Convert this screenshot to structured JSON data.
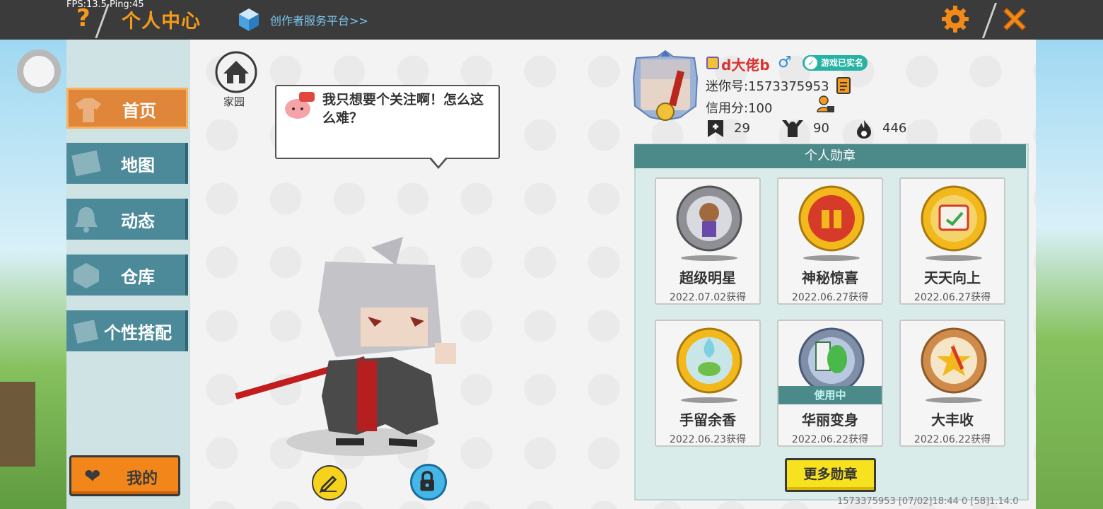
{
  "debug": {
    "fps_ping": "FPS:13.5  Ping:45"
  },
  "header": {
    "title": "个人中心",
    "creator_link": "创作者服务平台>>"
  },
  "sidebar": {
    "items": [
      {
        "label": "首页",
        "active": true
      },
      {
        "label": "地图"
      },
      {
        "label": "动态"
      },
      {
        "label": "仓库"
      },
      {
        "label": "个性搭配"
      }
    ],
    "mine_label": "我的"
  },
  "home": {
    "label": "家园"
  },
  "speech": {
    "text": "我只想要个关注啊！怎么这么难？"
  },
  "profile": {
    "username": "d大佬b",
    "gender_symbol": "♂",
    "verified": "游戏已实名",
    "mini_id": "迷你号:1573375953",
    "credit": "信用分:100",
    "stats": {
      "flag": "29",
      "fans": "90",
      "hot": "446"
    }
  },
  "medals": {
    "title": "个人勋章",
    "items": [
      {
        "name": "超级明星",
        "date": "2022.07.02获得"
      },
      {
        "name": "神秘惊喜",
        "date": "2022.06.27获得"
      },
      {
        "name": "天天向上",
        "date": "2022.06.27获得"
      },
      {
        "name": "手留余香",
        "date": "2022.06.23获得"
      },
      {
        "name": "华丽变身",
        "date": "2022.06.22获得",
        "status": "使用中"
      },
      {
        "name": "大丰收",
        "date": "2022.06.22获得"
      }
    ],
    "more_label": "更多勋章"
  },
  "footer": {
    "info": "1573375953    [07/02]18:44 0   [58]1.14.0"
  },
  "colors": {
    "accent": "#f59a1b",
    "teal": "#4c8a8a",
    "nav": "#4c8a99",
    "username": "#d8332f"
  }
}
